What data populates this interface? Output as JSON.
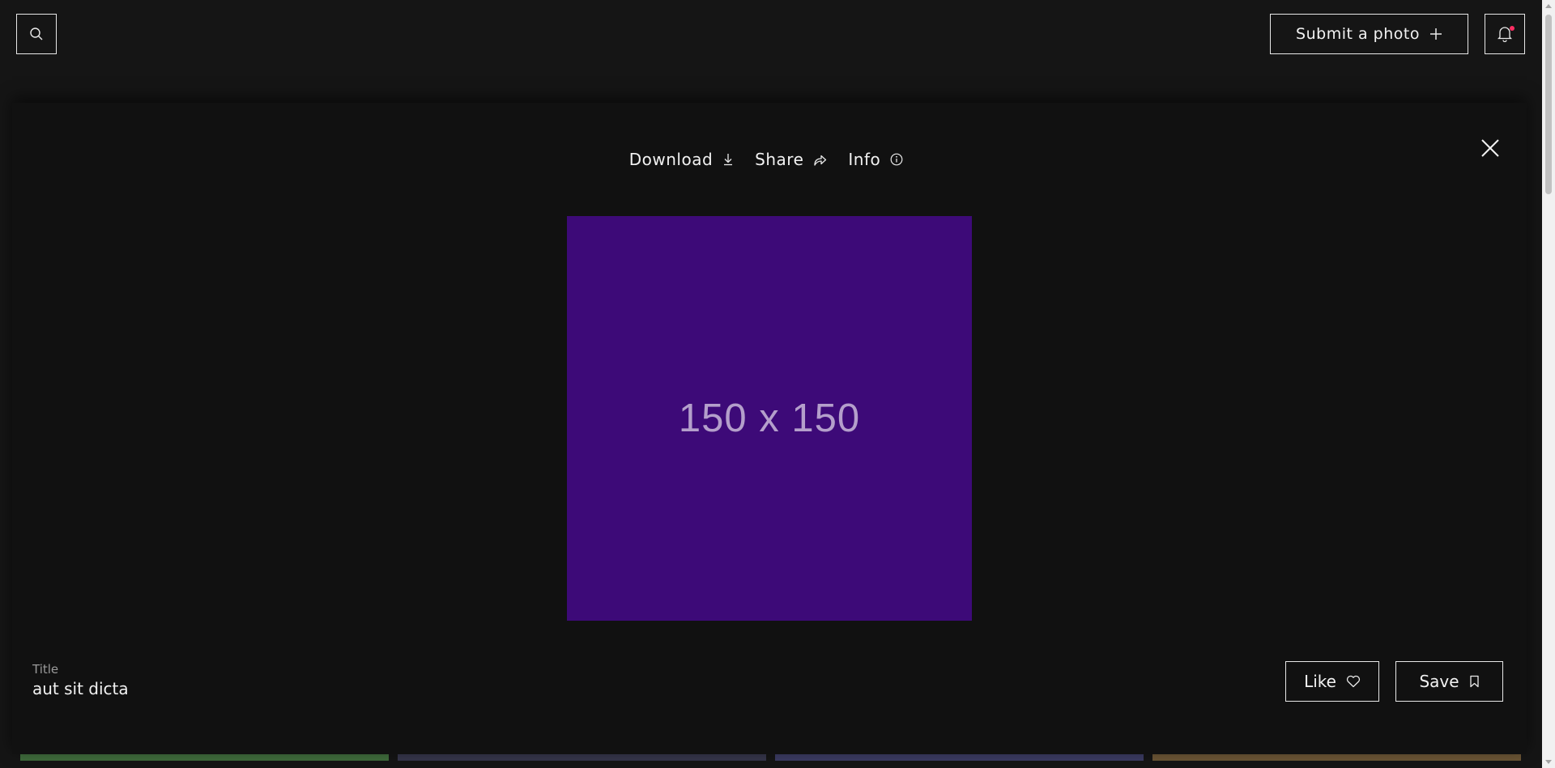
{
  "header": {
    "submit_label": "Submit a photo"
  },
  "modal": {
    "toolbar": {
      "download_label": "Download",
      "share_label": "Share",
      "info_label": "Info"
    },
    "photo": {
      "placeholder_text": "150 x 150",
      "background_color": "#3d0a78"
    },
    "title_label": "Title",
    "title_value": "aut sit dicta",
    "like_label": "Like",
    "save_label": "Save"
  },
  "colors": {
    "background": "#151515",
    "modal_background": "#111111",
    "notification_dot": "#ff2e63",
    "strip_colors": [
      "#3f6b3c",
      "#35354a",
      "#3b3b62",
      "#6b5535"
    ]
  }
}
